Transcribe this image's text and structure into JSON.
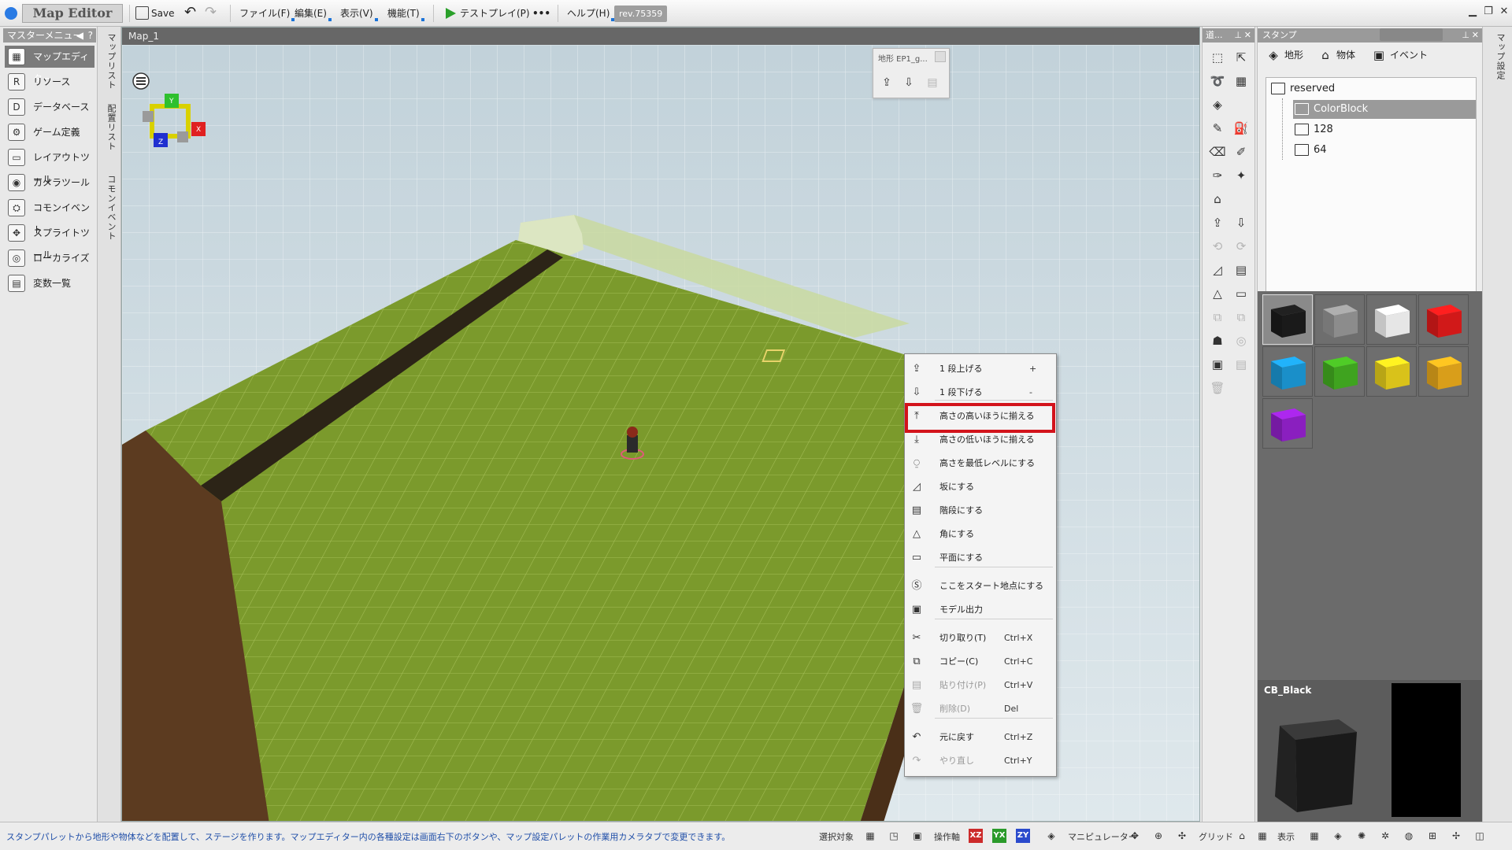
{
  "app": {
    "title": "Map Editor",
    "revision": "rev.75359"
  },
  "toolbar": {
    "save_label": "Save",
    "menus": [
      "ファイル(F)",
      "編集(E)",
      "表示(V)",
      "機能(T)"
    ],
    "testplay_label": "テストプレイ(P)",
    "more_label": "•••",
    "help_label": "ヘルプ(H)"
  },
  "master_menu": {
    "header": "マスターメニュー",
    "help_label": "?",
    "items": [
      {
        "label": "マップエディター",
        "icon": "map-editor-icon",
        "selected": true
      },
      {
        "label": "リソース",
        "icon": "resource-icon"
      },
      {
        "label": "データベース",
        "icon": "database-icon"
      },
      {
        "label": "ゲーム定義",
        "icon": "game-definition-icon"
      },
      {
        "label": "レイアウトツール",
        "icon": "layout-tool-icon"
      },
      {
        "label": "カメラツール",
        "icon": "camera-tool-icon"
      },
      {
        "label": "コモンイベント",
        "icon": "common-event-icon"
      },
      {
        "label": "スプライトツール",
        "icon": "sprite-tool-icon"
      },
      {
        "label": "ローカライズ",
        "icon": "localize-icon"
      },
      {
        "label": "変数一覧",
        "icon": "variable-list-icon"
      }
    ]
  },
  "vertical_tabs": [
    "マップリスト",
    "配置リスト",
    "コモンイベント"
  ],
  "viewport": {
    "tab_label": "Map_1",
    "terrain_stamp_title": "地形 EP1_g..."
  },
  "context_menu": {
    "items": [
      {
        "label": "1 段上げる",
        "shortcut": "+",
        "icon": "raise-icon",
        "disabled": false
      },
      {
        "label": "1 段下げる",
        "shortcut": "-",
        "icon": "lower-icon",
        "disabled": false
      },
      {
        "label": "高さの高いほうに揃える",
        "shortcut": "",
        "icon": "align-high-icon",
        "disabled": false,
        "highlighted": true
      },
      {
        "label": "高さの低いほうに揃える",
        "shortcut": "",
        "icon": "align-low-icon",
        "disabled": false
      },
      {
        "label": "高さを最低レベルにする",
        "shortcut": "",
        "icon": "min-level-icon",
        "disabled": false
      },
      {
        "label": "坂にする",
        "shortcut": "",
        "icon": "slope-icon",
        "disabled": false
      },
      {
        "label": "階段にする",
        "shortcut": "",
        "icon": "stairs-icon",
        "disabled": false
      },
      {
        "label": "角にする",
        "shortcut": "",
        "icon": "corner-icon",
        "disabled": false
      },
      {
        "label": "平面にする",
        "shortcut": "",
        "icon": "flat-icon",
        "disabled": false
      },
      {
        "label": "ここをスタート地点にする",
        "shortcut": "",
        "icon": "start-point-icon",
        "disabled": false
      },
      {
        "label": "モデル出力",
        "shortcut": "",
        "icon": "model-export-icon",
        "disabled": false
      },
      {
        "label": "切り取り(T)",
        "shortcut": "Ctrl+X",
        "icon": "cut-icon",
        "disabled": false
      },
      {
        "label": "コピー(C)",
        "shortcut": "Ctrl+C",
        "icon": "copy-icon",
        "disabled": false
      },
      {
        "label": "貼り付け(P)",
        "shortcut": "Ctrl+V",
        "icon": "paste-icon",
        "disabled": true
      },
      {
        "label": "削除(D)",
        "shortcut": "Del",
        "icon": "delete-icon",
        "disabled": true
      },
      {
        "label": "元に戻す",
        "shortcut": "Ctrl+Z",
        "icon": "undo-icon",
        "disabled": false
      },
      {
        "label": "やり直し",
        "shortcut": "Ctrl+Y",
        "icon": "redo-icon",
        "disabled": true
      }
    ]
  },
  "tool_panel": {
    "header": "道..."
  },
  "stamp_panel": {
    "header": "スタンプ",
    "tabs": [
      "地形",
      "物体",
      "イベント"
    ],
    "tree": [
      {
        "label": "reserved",
        "level": 0
      },
      {
        "label": "ColorBlock",
        "level": 1,
        "selected": true
      },
      {
        "label": "128",
        "level": 1
      },
      {
        "label": "64",
        "level": 1
      }
    ],
    "swatches": [
      {
        "name": "black",
        "color": "#1a1a1a",
        "selected": true
      },
      {
        "name": "gray",
        "color": "#8c8c8c"
      },
      {
        "name": "white",
        "color": "#e6e6e6"
      },
      {
        "name": "red",
        "color": "#d11919"
      },
      {
        "name": "cyan",
        "color": "#1a8fc9"
      },
      {
        "name": "green",
        "color": "#3fa31f"
      },
      {
        "name": "yellow",
        "color": "#d9c21a"
      },
      {
        "name": "orange",
        "color": "#d99e1a"
      },
      {
        "name": "purple",
        "color": "#8a1fbf"
      }
    ],
    "preview_name": "CB_Black"
  },
  "right_strip": {
    "label": "マップ設定"
  },
  "statusbar": {
    "message": "スタンプパレットから地形や物体などを配置して、ステージを作ります。マップエディター内の各種設定は画面右下のボタンや、マップ設定パレットの作業用カメラタブで変更できます。",
    "selection_label": "選択対象",
    "axis_label": "操作軸",
    "axes": [
      "XZ",
      "YX",
      "ZY"
    ],
    "manipulator_label": "マニピュレーター",
    "grid_label": "グリッド",
    "display_label": "表示"
  },
  "colors": {
    "grass": "#7a9a2a",
    "dirt": "#5a3a1e",
    "highlight": "#d3131b",
    "axis_xz": "#cc2a2a",
    "axis_yx": "#2a9a2a",
    "axis_zy": "#2a4acc"
  }
}
